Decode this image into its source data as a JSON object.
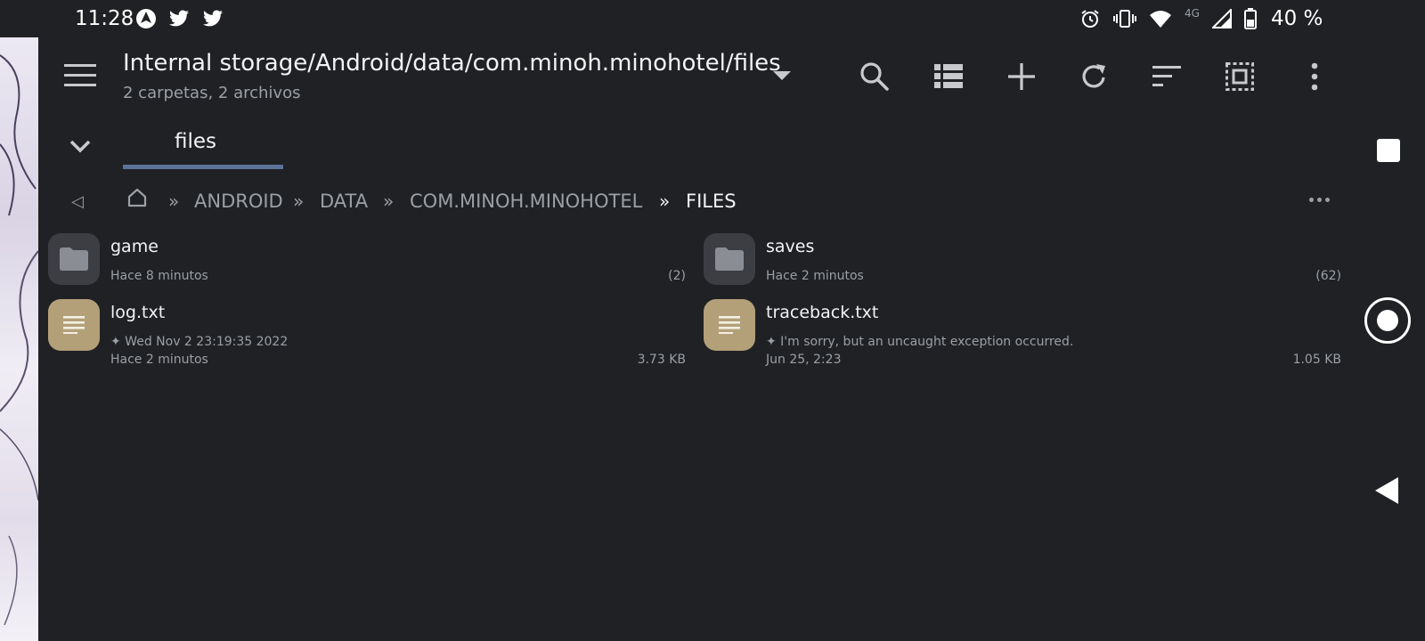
{
  "status_bar": {
    "time": "11:28",
    "battery_text": "40 %",
    "network": "4G",
    "left_icons": [
      "navigation-icon",
      "twitter-icon",
      "twitter-icon"
    ],
    "right_icons": [
      "alarm-icon",
      "vibrate-icon",
      "wifi-icon",
      "signal-icon",
      "battery-icon"
    ]
  },
  "toolbar": {
    "path": "Internal storage/Android/data/com.minoh.minohotel/files",
    "summary": "2 carpetas, 2 archivos",
    "actions": [
      "search-icon",
      "list-view-icon",
      "add-icon",
      "refresh-icon",
      "sort-icon",
      "select-all-icon",
      "more-vert-icon"
    ]
  },
  "tabs": [
    {
      "label": "files",
      "active": true
    }
  ],
  "breadcrumb": {
    "separator": "»",
    "items": [
      "ANDROID",
      "DATA",
      "COM.MINOH.MINOHOTEL",
      "FILES"
    ]
  },
  "files": [
    {
      "name": "game",
      "type": "folder",
      "sub1": "Hace 8 minutos",
      "sub2": "",
      "meta": "(2)"
    },
    {
      "name": "saves",
      "type": "folder",
      "sub1": "Hace 2 minutos",
      "sub2": "",
      "meta": "(62)"
    },
    {
      "name": "log.txt",
      "type": "doc",
      "sub1": "✦ Wed Nov  2 23:19:35 2022",
      "sub2": "Hace 2 minutos",
      "meta": "3.73  KB"
    },
    {
      "name": "traceback.txt",
      "type": "doc",
      "sub1": "✦ I'm sorry, but an uncaught exception occurred.",
      "sub2": "Jun 25, 2:23",
      "meta": "1.05  KB"
    }
  ],
  "colors": {
    "background": "#202124",
    "tab_indicator": "#5b7398",
    "folder_tile": "#3c3e43",
    "document_tile": "#b3a078"
  }
}
